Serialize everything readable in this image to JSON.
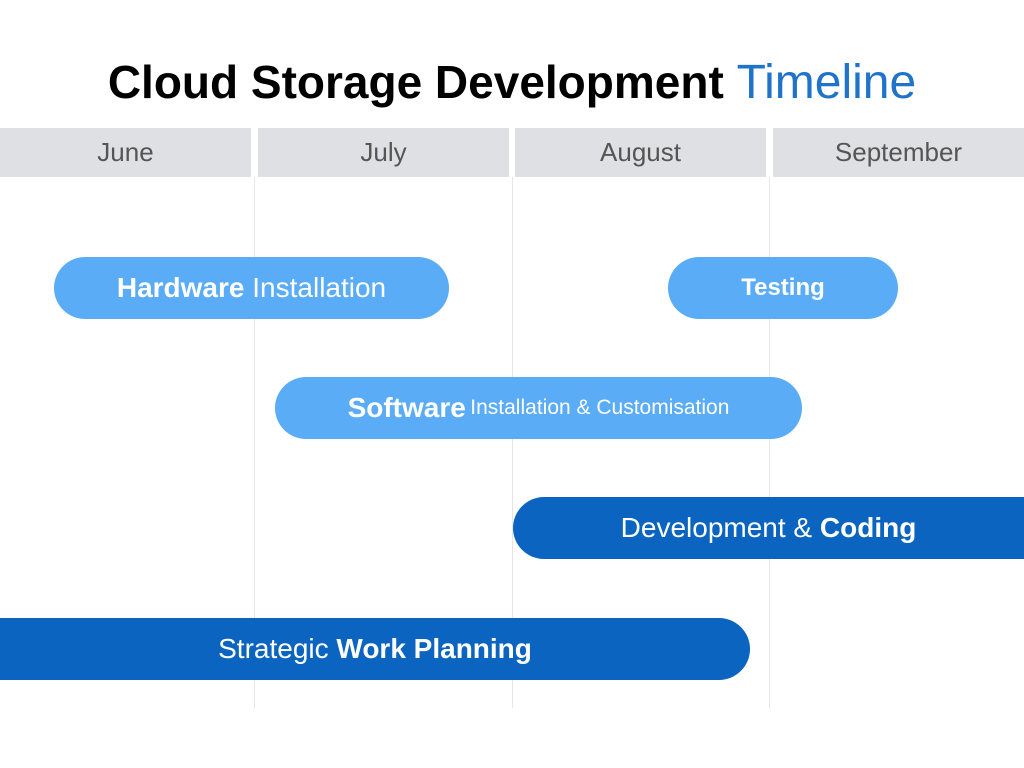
{
  "title": {
    "main": "Cloud Storage Development",
    "accent": "Timeline"
  },
  "months": [
    "June",
    "July",
    "August",
    "September"
  ],
  "tasks": {
    "hardware": {
      "strong": "Hardware",
      "rest": " Installation"
    },
    "testing": {
      "strong": "Testing"
    },
    "software": {
      "strong": "Software",
      "rest": " Installation & Customisation"
    },
    "development": {
      "lead": "Development & ",
      "strong": "Coding"
    },
    "planning": {
      "lead": "Strategic ",
      "strong": "Work Planning"
    }
  },
  "colors": {
    "light_bar": "#5aacf6",
    "dark_bar": "#0a64c0",
    "title_accent": "#1f73c9",
    "month_header": "#dfe0e3"
  }
}
